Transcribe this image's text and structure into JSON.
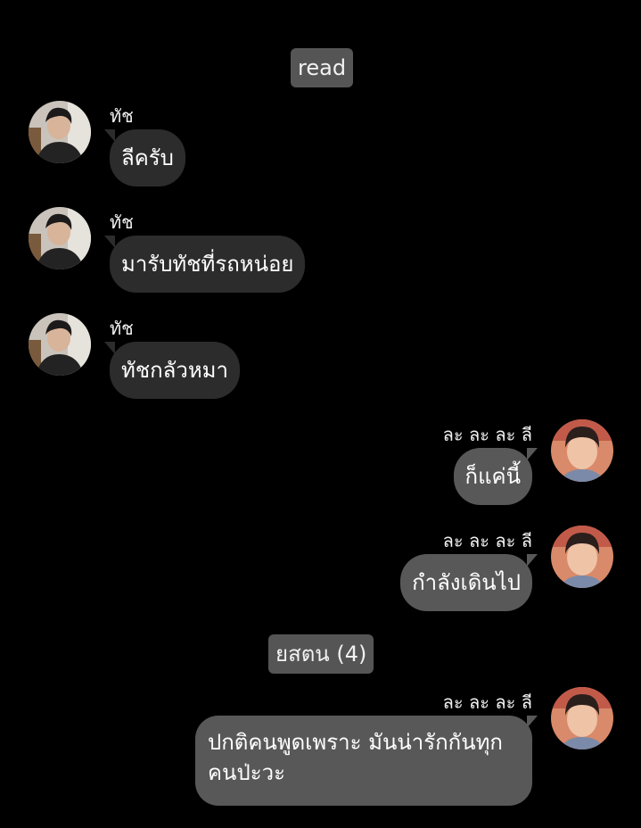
{
  "colors": {
    "background": "#000000",
    "incoming_bubble": "#2c2c2c",
    "outgoing_bubble": "#585858",
    "status_chip": "#555555"
  },
  "status": {
    "read_label": "read",
    "group_label": "ยสตน (4)"
  },
  "messages": [
    {
      "sender": "ทัช",
      "text": "ลีครับ",
      "avatar": "tach-avatar"
    },
    {
      "sender": "ทัช",
      "text": "มารับทัชที่รถหน่อย",
      "avatar": "tach-avatar"
    },
    {
      "sender": "ทัช",
      "text": "ทัชกลัวหมา",
      "avatar": "tach-avatar"
    },
    {
      "sender": "ละ ละ ละ ลี",
      "text": "ก็แค่นี้",
      "avatar": "lee-avatar"
    },
    {
      "sender": "ละ ละ ละ ลี",
      "text": "กำลังเดินไป",
      "avatar": "lee-avatar"
    },
    {
      "sender": "ละ ละ ละ ลี",
      "text": "ปกติคนพูดเพราะ มันน่ารักกันทุกคนป่ะวะ",
      "avatar": "lee-avatar"
    }
  ]
}
